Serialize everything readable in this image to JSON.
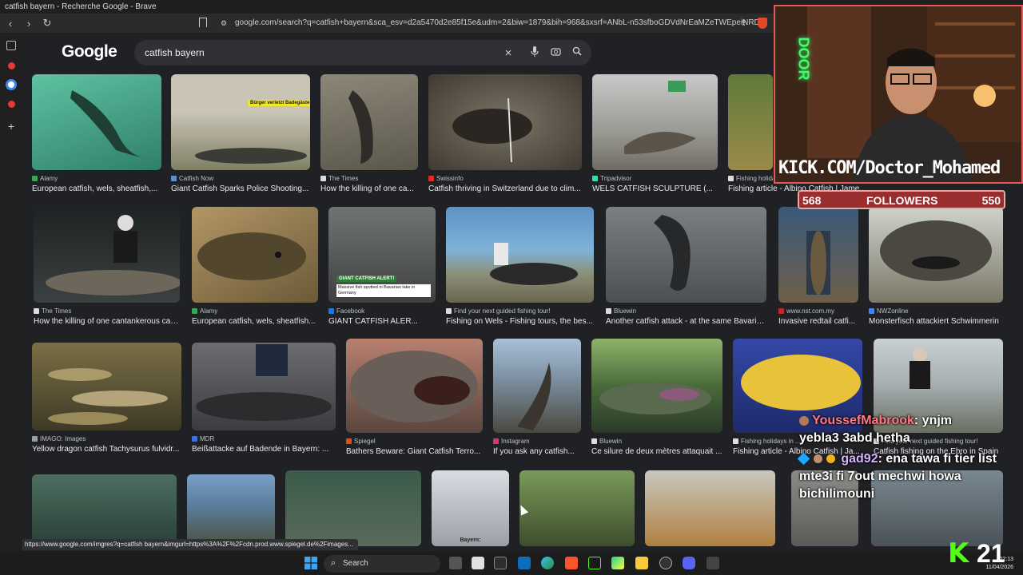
{
  "browser": {
    "window_title": "catfish bayern - Recherche Google - Brave",
    "url": "google.com/search?q=catfish+bayern&sca_esv=d2a5470d2e85f15e&udm=2&biw=1879&bih=968&sxsrf=ANbL-n53sfboGDVdNrEaMZeTWEpeiNRD...",
    "status_url": "https://www.google.com/imgres?q=catfish bayern&imgurl=https%3A%2F%2Fcdn.prod.www.spiegel.de%2Fimages..."
  },
  "google": {
    "logo": "Google",
    "query": "catfish bayern"
  },
  "results": [
    [
      {
        "source": "Alamy",
        "caption": "European catfish, wels, sheatfish,...",
        "fav": "#3aa757",
        "color": "#4aa58a"
      },
      {
        "source": "Catfish Now",
        "caption": "Giant Catfish Sparks Police Shooting...",
        "fav": "#5f8fd0",
        "color": "#8c8f74"
      },
      {
        "source": "The Times",
        "caption": "How the killing of one ca...",
        "fav": "#dddddd",
        "color": "#6e6a60"
      },
      {
        "source": "Swissinfo",
        "caption": "Catfish thriving in Switzerland due to clim...",
        "fav": "#d93025",
        "color": "#5b5246"
      },
      {
        "source": "Tripadvisor",
        "caption": "WELS CATFISH SCULPTURE (...",
        "fav": "#34e0a1",
        "color": "#8b8a82"
      },
      {
        "source": "Fishing holidays",
        "caption": "Fishing article - Albino Catfish | Jame...",
        "fav": "#dddddd",
        "color": "#6a7a3c"
      }
    ],
    [
      {
        "source": "The Times",
        "caption": "How the killing of one cantankerous catf...",
        "fav": "#dddddd",
        "color": "#2d3334"
      },
      {
        "source": "Alamy",
        "caption": "European catfish, wels, sheatfish...",
        "fav": "#3aa757",
        "color": "#6b6045"
      },
      {
        "source": "Facebook",
        "caption": "GIANT CATFISH ALER...",
        "fav": "#1877f2",
        "color": "#5a5f60"
      },
      {
        "source": "Find your next guided fishing tour!",
        "caption": "Fishing on Wels - Fishing tours, the bes...",
        "fav": "#dddddd",
        "color": "#4d7aa5"
      },
      {
        "source": "Bluewin",
        "caption": "Another catfish attack - at the same Bavaria...",
        "fav": "#dddddd",
        "color": "#5c5f62"
      },
      {
        "source": "www.nst.com.my",
        "caption": "Invasive redtail catfi...",
        "fav": "#c62828",
        "color": "#6f5f4a"
      },
      {
        "source": "NWZonline",
        "caption": "Monsterfisch attackiert Schwimmerin",
        "fav": "#4285f4",
        "color": "#5c5a4f"
      }
    ],
    [
      {
        "source": "IMAGO: Images",
        "caption": "Yellow dragon catfish Tachysurus fulvidr...",
        "fav": "#9aa0a6",
        "color": "#5e5a3e"
      },
      {
        "source": "MDR",
        "caption": "Beißattacke auf Badende in Bayern: ...",
        "fav": "#3f6fd8",
        "color": "#4a4c4f"
      },
      {
        "source": "Spiegel",
        "caption": "Bathers Beware: Giant Catfish Terro...",
        "fav": "#e64a19",
        "color": "#7a5a50"
      },
      {
        "source": "Instagram",
        "caption": "If you ask any catfish...",
        "fav": "#e1306c",
        "color": "#6f7d8a"
      },
      {
        "source": "Bluewin",
        "caption": "Ce silure de deux mètres attaquait ...",
        "fav": "#dddddd",
        "color": "#3f5a36"
      },
      {
        "source": "Fishing holidays in ...",
        "caption": "Fishing article - Albino Catfish | Ja...",
        "fav": "#dddddd",
        "color": "#3d56b8"
      },
      {
        "source": "Find your next guided fishing tour!",
        "caption": "Catfish fishing on the Ebro in Spain",
        "fav": "#dddddd",
        "color": "#8f9b9c"
      }
    ],
    [
      {
        "color": "#3c5a4e"
      },
      {
        "color": "#5d7fa0"
      },
      {
        "color": "#4a5b4c"
      },
      {
        "color": "#b7bdc3"
      },
      {
        "color": "#4e5e3b"
      },
      {
        "color": "#b08040"
      },
      {
        "color": "#777a76"
      },
      {
        "color": "#5e6a70"
      }
    ]
  ],
  "tile_overlays": {
    "r0c1_banner": "Bürger verletzt Badegäste",
    "r1c2_badge": "GIANT CATFISH ALERT!",
    "r1c2_sub": "Massive fish spotted in Bavarian lake in Germany",
    "r3c3_label": "Bayern:"
  },
  "stream": {
    "channel": "KICK.COM/Doctor_Mohamed",
    "followers_label": "FOLLOWERS",
    "followers_left": "568",
    "followers_right": "550",
    "neon_sign": "DOOR",
    "overlay_number": "21",
    "overlay_k": "K",
    "chat": [
      {
        "user": "YoussefMabrook",
        "message": ": ynjm",
        "color": "#ff7a86"
      },
      {
        "user": "",
        "message": "yebla3 3abd hetha",
        "color": "#ffffff"
      },
      {
        "user": "gad92",
        "message": ": ena tawa fi tier list mte3i fi 7out mechwi howa bichilimouni",
        "color": "#d8b4ff"
      }
    ]
  },
  "taskbar": {
    "search_label": "Search",
    "date": "11/04/2026",
    "time": "02:13"
  }
}
